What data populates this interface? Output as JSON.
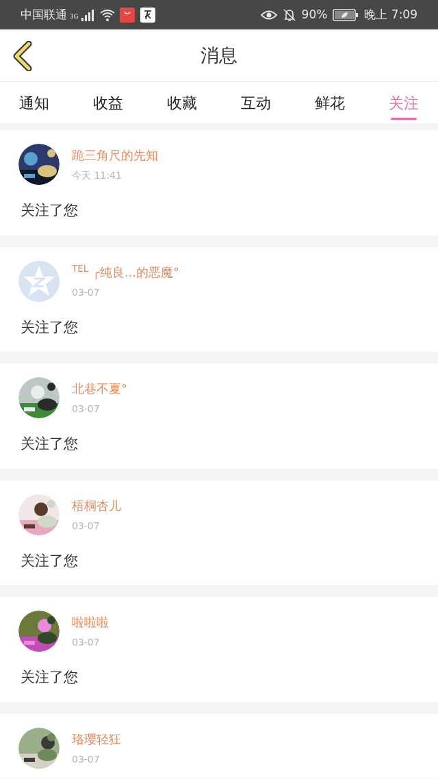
{
  "status_bar": {
    "carrier": "中国联通",
    "network": "3G",
    "battery": "90%",
    "time": "晚上 7:09"
  },
  "header": {
    "title": "消息"
  },
  "tabs": [
    {
      "label": "通知",
      "selected": false
    },
    {
      "label": "收益",
      "selected": false
    },
    {
      "label": "收藏",
      "selected": false
    },
    {
      "label": "互动",
      "selected": false
    },
    {
      "label": "鲜花",
      "selected": false
    },
    {
      "label": "关注",
      "selected": true
    }
  ],
  "messages": [
    {
      "name": "跪三角尺的先知",
      "time": "今天 11:41",
      "text": "关注了您"
    },
    {
      "avatar": {
        "kind": "default"
      },
      "name": "$^{TEL}$ ╭纯良...的恶魔°",
      "time": "03-07",
      "text": "关注了您"
    },
    {
      "name": "北巷不夏°",
      "time": "03-07",
      "text": "关注了您"
    },
    {
      "name": "梧桐杏儿",
      "time": "03-07",
      "text": "关注了您"
    },
    {
      "name": "啦啦啦",
      "time": "03-07",
      "text": "关注了您"
    },
    {
      "name": "珞璎轻狂",
      "time": "03-07"
    }
  ]
}
